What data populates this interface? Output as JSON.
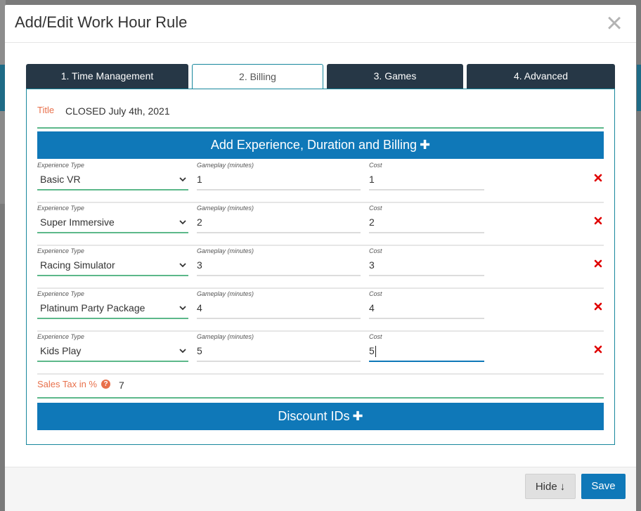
{
  "modal": {
    "title": "Add/Edit Work Hour Rule"
  },
  "tabs": [
    {
      "label": "1. Time Management",
      "active": false
    },
    {
      "label": "2. Billing",
      "active": true
    },
    {
      "label": "3. Games",
      "active": false
    },
    {
      "label": "4. Advanced",
      "active": false
    }
  ],
  "billing": {
    "title_label": "Title",
    "title_value": "CLOSED July 4th, 2021",
    "add_experience_label": "Add Experience, Duration and Billing",
    "col_labels": {
      "experience_type": "Experience Type",
      "gameplay": "Gameplay (minutes)",
      "cost": "Cost"
    },
    "rows": [
      {
        "experience_type": "Basic VR",
        "gameplay": "1",
        "cost": "1"
      },
      {
        "experience_type": "Super Immersive",
        "gameplay": "2",
        "cost": "2"
      },
      {
        "experience_type": "Racing Simulator",
        "gameplay": "3",
        "cost": "3"
      },
      {
        "experience_type": "Platinum Party Package",
        "gameplay": "4",
        "cost": "4"
      },
      {
        "experience_type": "Kids Play",
        "gameplay": "5",
        "cost": "5"
      }
    ],
    "sales_tax_label": "Sales Tax in %",
    "sales_tax_value": "7",
    "discount_label": "Discount IDs"
  },
  "footer": {
    "hide_label": "Hide",
    "save_label": "Save"
  },
  "colors": {
    "accent": "#0f78b8",
    "tab_dark": "#263746",
    "label_orange": "#e8704b",
    "underline_green": "#5cb88a",
    "remove_red": "#e00000"
  },
  "icons": {
    "close": "close-icon",
    "plus": "plus-icon",
    "chevron": "chevron-down-icon",
    "remove": "remove-icon",
    "help": "help-icon",
    "arrow": "arrow-down-icon"
  }
}
